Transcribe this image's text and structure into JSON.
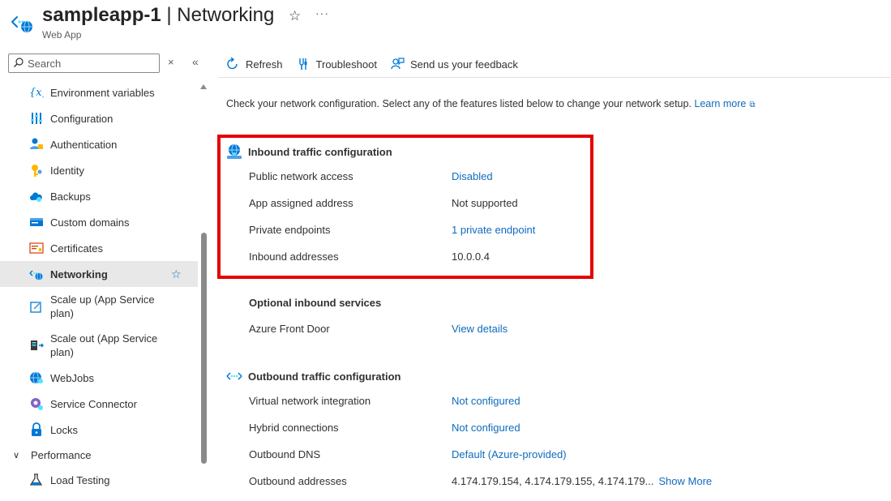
{
  "header": {
    "resource_name": "sampleapp-1",
    "separator": " | ",
    "page_name": "Networking",
    "resource_type": "Web App",
    "favorite_glyph": "☆",
    "more_glyph": "···"
  },
  "sidebar": {
    "search_placeholder": "Search",
    "close_glyph": "×",
    "collapse_glyph": "«",
    "items": [
      {
        "label": "Environment variables",
        "icon": "variables-icon"
      },
      {
        "label": "Configuration",
        "icon": "configuration-icon"
      },
      {
        "label": "Authentication",
        "icon": "authentication-icon"
      },
      {
        "label": "Identity",
        "icon": "identity-icon"
      },
      {
        "label": "Backups",
        "icon": "backups-icon"
      },
      {
        "label": "Custom domains",
        "icon": "custom-domains-icon"
      },
      {
        "label": "Certificates",
        "icon": "certificates-icon"
      },
      {
        "label": "Networking",
        "icon": "networking-icon",
        "selected": true,
        "fav": "☆"
      },
      {
        "label": "Scale up (App Service plan)",
        "icon": "scale-up-icon"
      },
      {
        "label": "Scale out (App Service plan)",
        "icon": "scale-out-icon"
      },
      {
        "label": "WebJobs",
        "icon": "webjobs-icon"
      },
      {
        "label": "Service Connector",
        "icon": "service-connector-icon"
      },
      {
        "label": "Locks",
        "icon": "lock-icon"
      }
    ],
    "group": {
      "label": "Performance",
      "chevron": "∨"
    },
    "group_items": [
      {
        "label": "Load Testing",
        "icon": "load-testing-icon"
      }
    ]
  },
  "toolbar": {
    "refresh_label": "Refresh",
    "troubleshoot_label": "Troubleshoot",
    "feedback_label": "Send us your feedback"
  },
  "intro": {
    "text": "Check your network configuration. Select any of the features listed below to change your network setup. ",
    "link": "Learn more"
  },
  "inbound": {
    "title": "Inbound traffic configuration",
    "rows": [
      {
        "label": "Public network access",
        "value": "Disabled",
        "link": true
      },
      {
        "label": "App assigned address",
        "value": "Not supported",
        "link": false
      },
      {
        "label": "Private endpoints",
        "value": "1 private endpoint",
        "link": true
      },
      {
        "label": "Inbound addresses",
        "value": "10.0.0.4",
        "link": false
      }
    ]
  },
  "optional_inbound": {
    "title": "Optional inbound services",
    "rows": [
      {
        "label": "Azure Front Door",
        "value": "View details",
        "link": true
      }
    ]
  },
  "outbound": {
    "title": "Outbound traffic configuration",
    "rows": [
      {
        "label": "Virtual network integration",
        "value": "Not configured",
        "link": true
      },
      {
        "label": "Hybrid connections",
        "value": "Not configured",
        "link": true
      },
      {
        "label": "Outbound DNS",
        "value": "Default (Azure-provided)",
        "link": true
      },
      {
        "label": "Outbound addresses",
        "value": "4.174.179.154, 4.174.179.155, 4.174.179...",
        "link": false,
        "more": "Show More"
      }
    ]
  },
  "colors": {
    "link": "#0f6cbd",
    "highlight": "#e50000",
    "selected_bg": "#e8e8e8"
  }
}
